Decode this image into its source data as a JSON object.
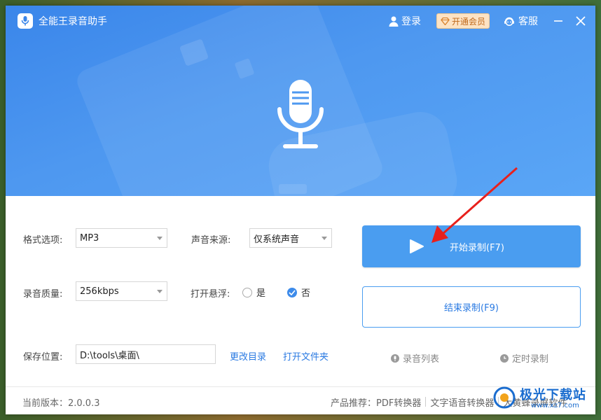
{
  "app": {
    "title": "全能王录音助手",
    "login": "登录",
    "vip": "开通会员",
    "service": "客服"
  },
  "settings": {
    "format_label": "格式选项:",
    "format_value": "MP3",
    "source_label": "声音来源:",
    "source_value": "仅系统声音",
    "quality_label": "录音质量:",
    "quality_value": "256kbps",
    "float_label": "打开悬浮:",
    "float_yes": "是",
    "float_no": "否",
    "float_selected": "否",
    "save_label": "保存位置:",
    "save_path": "D:\\tools\\桌面\\",
    "change_dir": "更改目录",
    "open_folder": "打开文件夹"
  },
  "actions": {
    "start": "开始录制(F7)",
    "stop": "结束录制(F9)",
    "record_list": "录音列表",
    "timed_record": "定时录制"
  },
  "footer": {
    "version": "当前版本：2.0.0.3",
    "recommend_label": "产品推荐：",
    "products": [
      "PDF转换器",
      "文字语音转换器",
      "大黄蜂录屏软件"
    ]
  },
  "watermark": {
    "brand": "极光下载站",
    "url": "www.xz7.com"
  },
  "colors": {
    "accent": "#4a9df0",
    "header": "#4e98f0",
    "link": "#2a7ae2",
    "arrow": "#e8201c"
  }
}
